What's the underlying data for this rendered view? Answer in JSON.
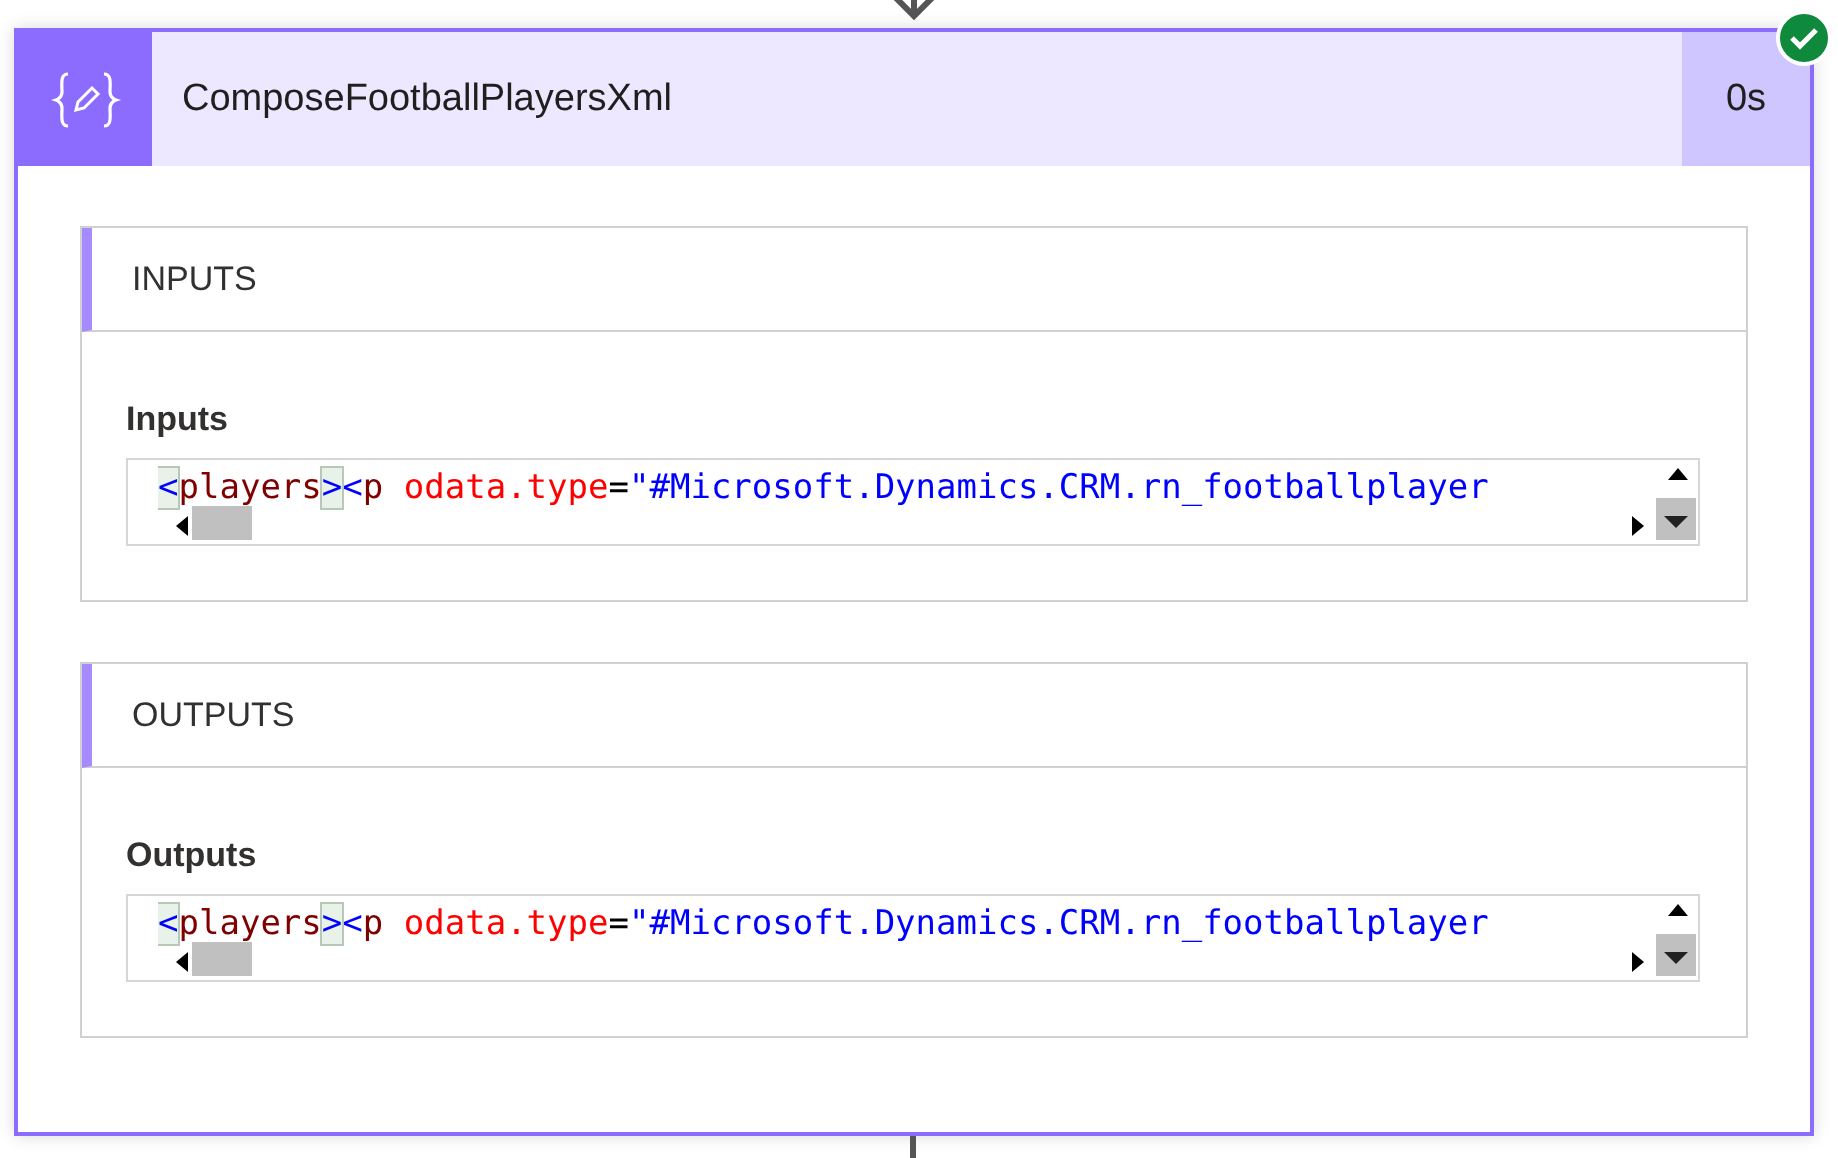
{
  "action": {
    "title": "ComposeFootballPlayersXml",
    "duration": "0s",
    "succeeded": true
  },
  "sections": [
    {
      "heading": "INPUTS",
      "label": "Inputs",
      "code": [
        {
          "text": "<",
          "kind": "bracket-match"
        },
        {
          "text": "players",
          "kind": "tag"
        },
        {
          "text": ">",
          "kind": "bracket-match"
        },
        {
          "text": "<",
          "kind": "bracket"
        },
        {
          "text": "p",
          "kind": "tag"
        },
        {
          "text": " odata.type",
          "kind": "attr"
        },
        {
          "text": "=",
          "kind": "plain"
        },
        {
          "text": "\"#Microsoft.Dynamics.CRM.rn_footballplayer",
          "kind": "string"
        }
      ]
    },
    {
      "heading": "OUTPUTS",
      "label": "Outputs",
      "code": [
        {
          "text": "<",
          "kind": "bracket-match"
        },
        {
          "text": "players",
          "kind": "tag"
        },
        {
          "text": ">",
          "kind": "bracket-match"
        },
        {
          "text": "<",
          "kind": "bracket"
        },
        {
          "text": "p",
          "kind": "tag"
        },
        {
          "text": " odata.type",
          "kind": "attr"
        },
        {
          "text": "=",
          "kind": "plain"
        },
        {
          "text": "\"#Microsoft.Dynamics.CRM.rn_footballplayer",
          "kind": "string"
        }
      ]
    }
  ]
}
